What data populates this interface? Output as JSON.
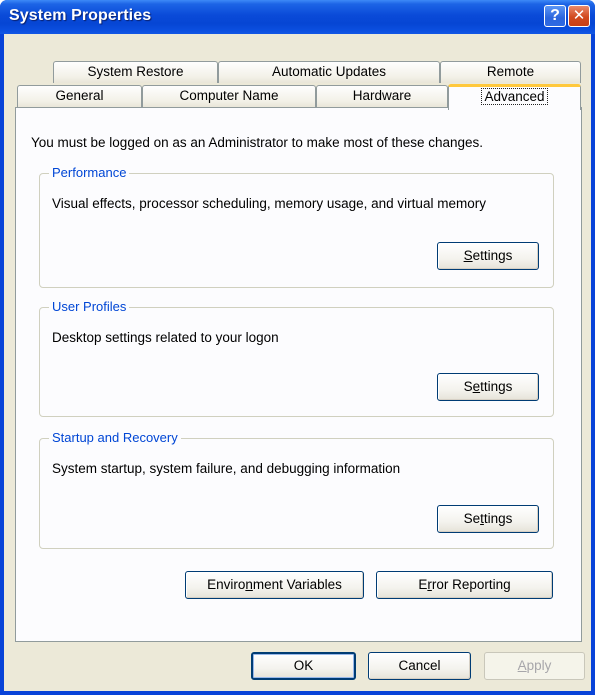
{
  "window": {
    "title": "System Properties",
    "help_glyph": "?",
    "close_glyph": "✕"
  },
  "tabs": {
    "row1": [
      "System Restore",
      "Automatic Updates",
      "Remote"
    ],
    "row2": [
      "General",
      "Computer Name",
      "Hardware",
      "Advanced"
    ],
    "active": "Advanced"
  },
  "notice": "You must be logged on as an Administrator to make most of these changes.",
  "groups": [
    {
      "title": "Performance",
      "description": "Visual effects, processor scheduling, memory usage, and virtual memory",
      "button": "Settings"
    },
    {
      "title": "User Profiles",
      "description": "Desktop settings related to your logon",
      "button": "Settings"
    },
    {
      "title": "Startup and Recovery",
      "description": "System startup, system failure, and debugging information",
      "button": "Settings"
    }
  ],
  "bottom_buttons": {
    "environment": "Environment Variables",
    "error_reporting": "Error Reporting"
  },
  "dialog_buttons": {
    "ok": "OK",
    "cancel": "Cancel",
    "apply": "Apply"
  },
  "colors": {
    "titlebar": "#0a4ad8",
    "group_title": "#0046d5",
    "active_tab_highlight": "#ffc83c",
    "dialog_bg": "#ece9d8"
  }
}
